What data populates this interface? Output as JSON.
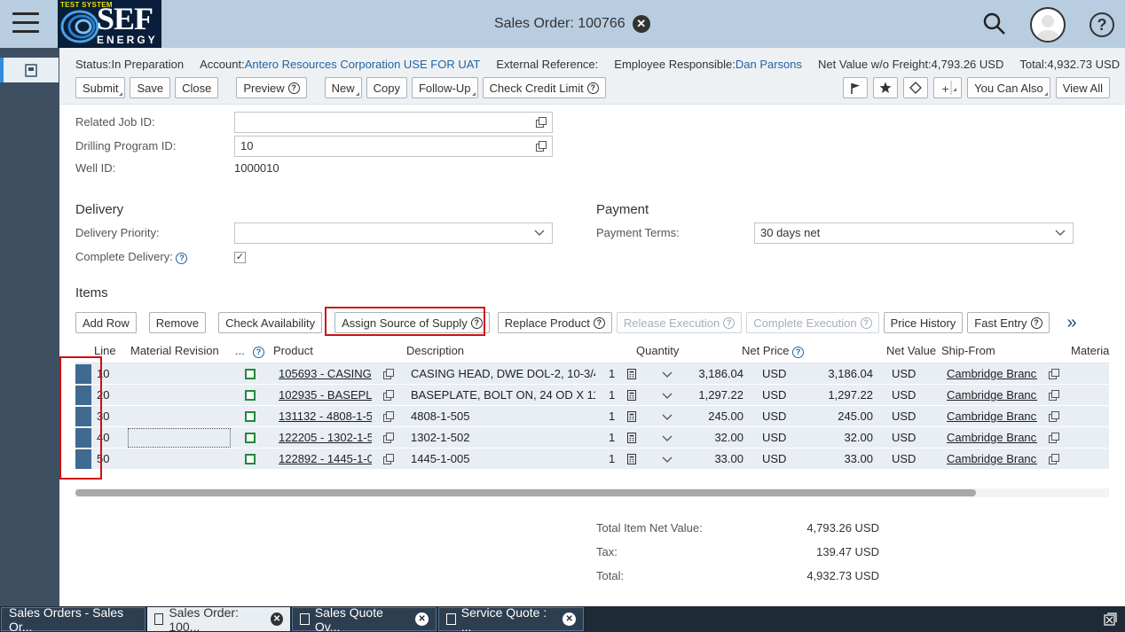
{
  "header": {
    "title": "Sales Order: 100766",
    "logo_top": "TEST SYSTEM",
    "logo_main": "SEF",
    "logo_sub": "ENERGY"
  },
  "info": {
    "status_label": "Status:",
    "status_value": "In Preparation",
    "account_label": "Account:",
    "account_value": "Antero Resources Corporation USE FOR UAT",
    "extref_label": "External Reference:",
    "emp_label": "Employee Responsible:",
    "emp_value": "Dan Parsons",
    "netvalue_label": "Net Value w/o Freight:",
    "netvalue_value": "4,793.26 USD",
    "total_label": "Total:",
    "total_value": "4,932.73 USD"
  },
  "toolbar": {
    "submit": "Submit",
    "save": "Save",
    "close": "Close",
    "preview": "Preview",
    "new": "New",
    "copy": "Copy",
    "followup": "Follow-Up",
    "creditlimit": "Check Credit Limit",
    "youcanalso": "You Can Also",
    "viewall": "View All"
  },
  "form": {
    "related_job_label": "Related Job ID:",
    "related_job_value": "",
    "drilling_label": "Drilling Program ID:",
    "drilling_value": "10",
    "well_label": "Well ID:",
    "well_value": "1000010",
    "delivery_head": "Delivery",
    "delivery_priority_label": "Delivery Priority:",
    "delivery_priority_value": "",
    "complete_delivery_label": "Complete Delivery:",
    "complete_delivery_checked": true,
    "payment_head": "Payment",
    "payment_terms_label": "Payment Terms:",
    "payment_terms_value": "30 days net",
    "items_head": "Items"
  },
  "itembar": {
    "add_row": "Add Row",
    "remove": "Remove",
    "check_avail": "Check Availability",
    "assign_source": "Assign Source of Supply",
    "replace_product": "Replace Product",
    "release_exec": "Release Execution",
    "complete_exec": "Complete Execution",
    "price_history": "Price History",
    "fast_entry": "Fast Entry",
    "more": "»"
  },
  "table": {
    "headers": {
      "line": "Line",
      "material_revision": "Material Revision",
      "dots": "...",
      "product": "Product",
      "description": "Description",
      "quantity": "Quantity",
      "net_price": "Net Price",
      "net_value": "Net Value",
      "ship_from": "Ship-From",
      "material": "Materia"
    },
    "rows": [
      {
        "line": "10",
        "product": "105693 - CASING",
        "description": "CASING HEAD, DWE DOL-2, 10-3/4",
        "qty": "1",
        "price": "3,186.04",
        "price_cur": "USD",
        "value": "3,186.04",
        "value_cur": "USD",
        "ship": "Cambridge Branch"
      },
      {
        "line": "20",
        "product": "102935 - BASEPLA",
        "description": "BASEPLATE, BOLT ON, 24 OD X 11",
        "qty": "1",
        "price": "1,297.22",
        "price_cur": "USD",
        "value": "1,297.22",
        "value_cur": "USD",
        "ship": "Cambridge Branch"
      },
      {
        "line": "30",
        "product": "131132 - 4808-1-5",
        "description": "4808-1-505",
        "qty": "1",
        "price": "245.00",
        "price_cur": "USD",
        "value": "245.00",
        "value_cur": "USD",
        "ship": "Cambridge Branch"
      },
      {
        "line": "40",
        "product": "122205 - 1302-1-5",
        "description": "1302-1-502",
        "qty": "1",
        "price": "32.00",
        "price_cur": "USD",
        "value": "32.00",
        "value_cur": "USD",
        "ship": "Cambridge Branch"
      },
      {
        "line": "50",
        "product": "122892 - 1445-1-0",
        "description": "1445-1-005",
        "qty": "1",
        "price": "33.00",
        "price_cur": "USD",
        "value": "33.00",
        "value_cur": "USD",
        "ship": "Cambridge Branch"
      }
    ]
  },
  "totals": {
    "net_label": "Total Item Net Value:",
    "net_value": "4,793.26 USD",
    "tax_label": "Tax:",
    "tax_value": "139.47 USD",
    "total_label": "Total:",
    "total_value": "4,932.73 USD"
  },
  "taskbar": {
    "tab1": "Sales Orders - Sales Or...",
    "tab2": "Sales Order: 100...",
    "tab3": "Sales Quote Ov...",
    "tab4": "Service Quote : ..."
  },
  "colors": {
    "header_bg": "#b8cde0",
    "sidebar_bg": "#3d4f61",
    "link": "#2264a0",
    "highlight_red": "#d01010",
    "selected_row": "#3f6a92"
  }
}
